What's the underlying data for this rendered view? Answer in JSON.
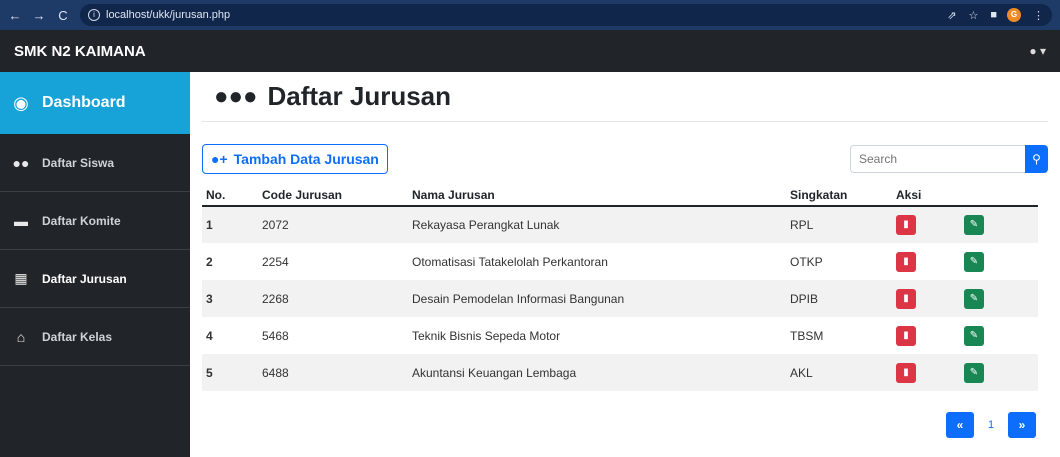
{
  "browser": {
    "url": "localhost/ukk/jurusan.php",
    "avatar_letter": "G"
  },
  "navbar": {
    "brand": "SMK N2 KAIMANA",
    "user_icon": "user-icon"
  },
  "sidebar": {
    "items": [
      {
        "label": "Dashboard",
        "icon": "dashboard-icon"
      },
      {
        "label": "Daftar Siswa",
        "icon": "users-icon"
      },
      {
        "label": "Daftar Komite",
        "icon": "id-card-icon"
      },
      {
        "label": "Daftar Jurusan",
        "icon": "building-icon"
      },
      {
        "label": "Daftar Kelas",
        "icon": "institution-icon"
      }
    ]
  },
  "main": {
    "title": "Daftar Jurusan",
    "add_button": "Tambah Data Jurusan",
    "search_placeholder": "Search",
    "table": {
      "headers": [
        "No.",
        "Code Jurusan",
        "Nama Jurusan",
        "Singkatan",
        "Aksi"
      ],
      "rows": [
        {
          "no": "1",
          "code": "2072",
          "nama": "Rekayasa Perangkat Lunak",
          "singkatan": "RPL"
        },
        {
          "no": "2",
          "code": "2254",
          "nama": "Otomatisasi Tatakelolah Perkantoran",
          "singkatan": "OTKP"
        },
        {
          "no": "3",
          "code": "2268",
          "nama": "Desain Pemodelan Informasi Bangunan",
          "singkatan": "DPIB"
        },
        {
          "no": "4",
          "code": "5468",
          "nama": "Teknik Bisnis Sepeda Motor",
          "singkatan": "TBSM"
        },
        {
          "no": "5",
          "code": "6488",
          "nama": "Akuntansi Keuangan Lembaga",
          "singkatan": "AKL"
        }
      ]
    },
    "pagination": {
      "prev": "«",
      "page": "1",
      "next": "»"
    }
  },
  "colors": {
    "primary": "#0d6efd",
    "sidebar_active": "#17a2d8",
    "danger": "#dc3545",
    "success": "#198754",
    "dark": "#212529"
  }
}
